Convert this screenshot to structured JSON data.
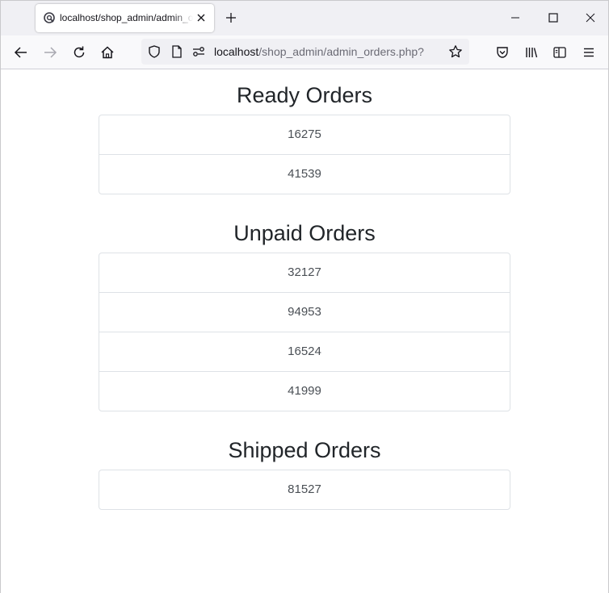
{
  "browser": {
    "tab_title": "localhost/shop_admin/admin_orders.php?",
    "url_host": "localhost",
    "url_path": "/shop_admin/admin_orders.php?"
  },
  "sections": [
    {
      "title": "Ready Orders",
      "orders": [
        "16275",
        "41539"
      ]
    },
    {
      "title": "Unpaid Orders",
      "orders": [
        "32127",
        "94953",
        "16524",
        "41999"
      ]
    },
    {
      "title": "Shipped Orders",
      "orders": [
        "81527"
      ]
    }
  ]
}
